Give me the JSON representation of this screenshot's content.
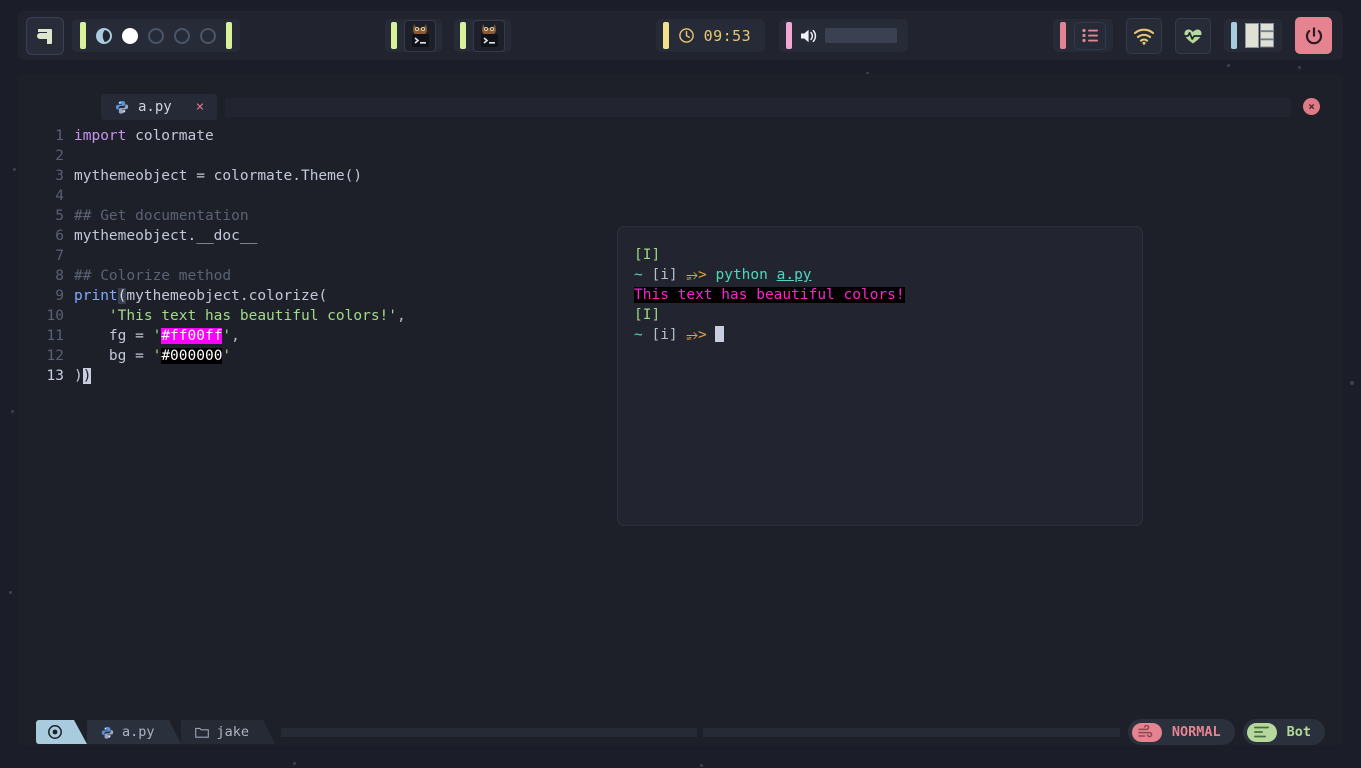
{
  "topbar": {
    "launcher": {
      "name": "launcher-logo",
      "label": "a"
    },
    "workspaces": [
      {
        "state": "occupied"
      },
      {
        "state": "active"
      },
      {
        "state": "empty"
      },
      {
        "state": "empty"
      },
      {
        "state": "empty"
      }
    ],
    "taskbar_windows": [
      {
        "label": "terminal-window-1"
      },
      {
        "label": "terminal-window-2"
      }
    ],
    "clock": {
      "time": "09:53",
      "icon": "clock-icon"
    },
    "volume": {
      "icon": "speaker-icon",
      "level": 85
    },
    "tray": [
      {
        "name": "notification-list-icon",
        "accent": "#e58391"
      },
      {
        "name": "wifi-icon",
        "accent": "#e8c874"
      },
      {
        "name": "heart-pulse-icon",
        "accent": "#b5d99c"
      },
      {
        "name": "layout-icon",
        "accent": "#a8cbdd"
      },
      {
        "name": "power-icon",
        "accent": "#e58391"
      }
    ]
  },
  "editor": {
    "tab": {
      "filename": "a.py",
      "icon": "python-icon",
      "close": "×"
    },
    "window_close": "×",
    "lines": [
      {
        "n": "1",
        "tokens": [
          {
            "t": "import",
            "c": "kw"
          },
          {
            "t": " colormate",
            "c": "code-text"
          }
        ]
      },
      {
        "n": "2",
        "tokens": []
      },
      {
        "n": "3",
        "tokens": [
          {
            "t": "mythemeobject = colormate.Theme()",
            "c": "code-text"
          }
        ]
      },
      {
        "n": "4",
        "tokens": []
      },
      {
        "n": "5",
        "tokens": [
          {
            "t": "## Get documentation",
            "c": "comment"
          }
        ]
      },
      {
        "n": "6",
        "tokens": [
          {
            "t": "mythemeobject.__doc__",
            "c": "code-text"
          }
        ]
      },
      {
        "n": "7",
        "tokens": []
      },
      {
        "n": "8",
        "tokens": [
          {
            "t": "## Colorize method",
            "c": "comment"
          }
        ]
      },
      {
        "n": "9",
        "tokens": [
          {
            "t": "print",
            "c": "fn"
          },
          {
            "t": "(",
            "c": "matchp"
          },
          {
            "t": "mythemeobject.colorize(",
            "c": "code-text"
          }
        ]
      },
      {
        "n": "10",
        "tokens": [
          {
            "t": "    ",
            "c": "code-text"
          },
          {
            "t": "'This text has beautiful colors!'",
            "c": "str"
          },
          {
            "t": ",",
            "c": "punct"
          }
        ]
      },
      {
        "n": "11",
        "tokens": [
          {
            "t": "    fg = ",
            "c": "code-text"
          },
          {
            "t": "'",
            "c": "str"
          },
          {
            "t": "#ff00ff",
            "c": "hl-magenta"
          },
          {
            "t": "'",
            "c": "str"
          },
          {
            "t": ",",
            "c": "punct"
          }
        ]
      },
      {
        "n": "12",
        "tokens": [
          {
            "t": "    bg = ",
            "c": "code-text"
          },
          {
            "t": "'",
            "c": "str"
          },
          {
            "t": "#000000",
            "c": "hl-black"
          },
          {
            "t": "'",
            "c": "str"
          }
        ]
      },
      {
        "n": "13",
        "tokens": [
          {
            "t": ")",
            "c": "code-text"
          },
          {
            "t": ")",
            "c": "blockcur"
          }
        ],
        "current": true
      }
    ]
  },
  "terminal": {
    "lines": [
      [
        {
          "t": "[I]",
          "c": "t-bracket"
        }
      ],
      [
        {
          "t": "~",
          "c": "t-tilde"
        },
        {
          "t": " ",
          "c": "t-idx"
        },
        {
          "t": "[i]",
          "c": "t-idx"
        },
        {
          "t": " ",
          "c": "t-idx"
        },
        {
          "t": "⭈>",
          "c": "t-arrow"
        },
        {
          "t": " ",
          "c": "t-idx"
        },
        {
          "t": "python",
          "c": "t-cmd"
        },
        {
          "t": " ",
          "c": "t-idx"
        },
        {
          "t": "a.py",
          "c": "t-file"
        }
      ],
      [
        {
          "t": "This text has beautiful colors!",
          "c": "t-out"
        }
      ],
      [
        {
          "t": "[I]",
          "c": "t-bracket"
        }
      ],
      [
        {
          "t": "~",
          "c": "t-tilde"
        },
        {
          "t": " ",
          "c": "t-idx"
        },
        {
          "t": "[i]",
          "c": "t-idx"
        },
        {
          "t": " ",
          "c": "t-idx"
        },
        {
          "t": "⭈>",
          "c": "t-arrow"
        },
        {
          "t": " ",
          "c": "t-idx"
        },
        {
          "t": "",
          "c": "cursor"
        }
      ]
    ]
  },
  "statusbar": {
    "mode_icon": "record-icon",
    "file": {
      "label": "a.py",
      "icon": "python-icon"
    },
    "project": {
      "label": "jake",
      "icon": "folder-icon"
    },
    "mode_pill": {
      "label": "NORMAL",
      "icon": "wind-icon",
      "color": "#e58391"
    },
    "position_pill": {
      "label": "Bot",
      "icon": "lines-icon",
      "color": "#b5d99c"
    }
  }
}
